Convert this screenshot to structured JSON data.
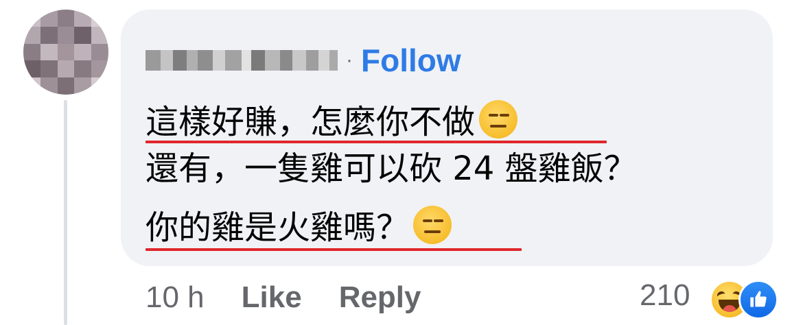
{
  "comment": {
    "follow_label": "Follow",
    "separator": "·",
    "lines": [
      "這樣好賺，怎麼你不做",
      "還有，一隻雞可以砍 24 盤雞飯？",
      "你的雞是火雞嗎？"
    ],
    "line_emojis": [
      "expressionless-emoji",
      "",
      "expressionless-emoji"
    ]
  },
  "actions": {
    "time": "10 h",
    "like_label": "Like",
    "reply_label": "Reply"
  },
  "reactions": {
    "count": "210",
    "icons": [
      "haha-reaction-icon",
      "like-reaction-icon"
    ]
  },
  "colors": {
    "bubble": "#f0f2f5",
    "follow": "#2e7be6",
    "underline": "#e0262c",
    "meta_text": "#65676b",
    "like_blue": "#1877f2"
  }
}
